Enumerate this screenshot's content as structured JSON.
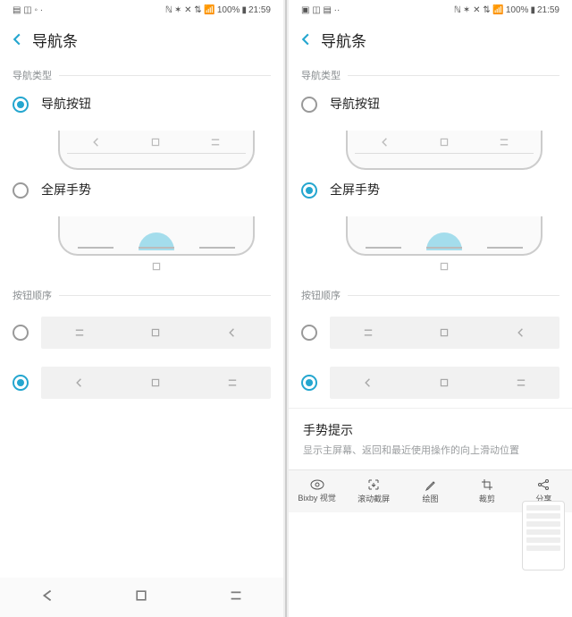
{
  "status": {
    "battery": "100%",
    "time": "21:59"
  },
  "header": {
    "title": "导航条"
  },
  "sections": {
    "navType": "导航类型",
    "btnOrder": "按钮顺序"
  },
  "options": {
    "navButtons": "导航按钮",
    "fullGestures": "全屏手势"
  },
  "hint": {
    "title": "手势提示",
    "body": "显示主屏幕、返回和最近使用操作的向上滑动位置"
  },
  "share": {
    "bixby": "Bixby 视觉",
    "scroll": "滚动截屏",
    "draw": "绘图",
    "crop": "裁剪",
    "share": "分享"
  }
}
